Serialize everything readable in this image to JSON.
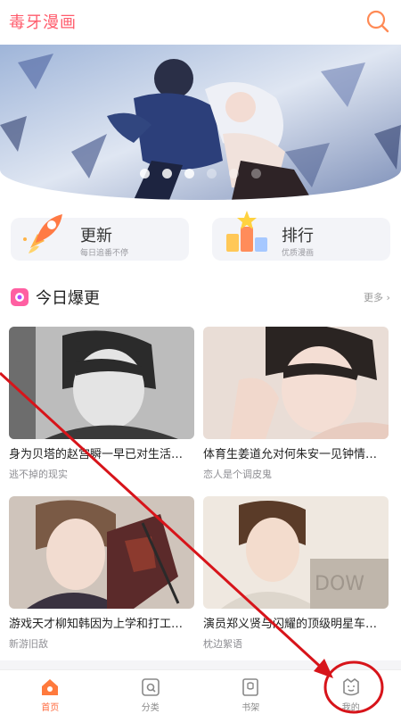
{
  "header": {
    "title": "毒牙漫画",
    "search_icon": "search-icon"
  },
  "banner": {
    "slides": 6,
    "active_index": 0
  },
  "quick_entries": [
    {
      "title": "更新",
      "subtitle": "每日追番不停",
      "icon": "rocket-icon"
    },
    {
      "title": "排行",
      "subtitle": "优质漫画",
      "icon": "podium-icon"
    }
  ],
  "section": {
    "title": "今日爆更",
    "more": "更多 ›",
    "icon": "flower-icon"
  },
  "cards": [
    {
      "title": "身为贝塔的赵宫瞬一早已对生活…",
      "author": "逃不掉的现实"
    },
    {
      "title": "体育生姜道允对何朱安一见钟情…",
      "author": "恋人是个调皮鬼"
    },
    {
      "title": "游戏天才柳知韩因为上学和打工…",
      "author": "新游旧敌"
    },
    {
      "title": "演员郑义贤与闪耀的顶级明星车…",
      "author": "枕边絮语"
    }
  ],
  "tabbar": [
    {
      "label": "首页",
      "icon": "home-icon",
      "active": true
    },
    {
      "label": "分类",
      "icon": "category-icon",
      "active": false
    },
    {
      "label": "书架",
      "icon": "bookshelf-icon",
      "active": false
    },
    {
      "label": "我的",
      "icon": "profile-icon",
      "active": false
    }
  ],
  "colors": {
    "brand": "#ff5c6c",
    "accent": "#ff6a3d",
    "annotation": "#d7141a"
  }
}
